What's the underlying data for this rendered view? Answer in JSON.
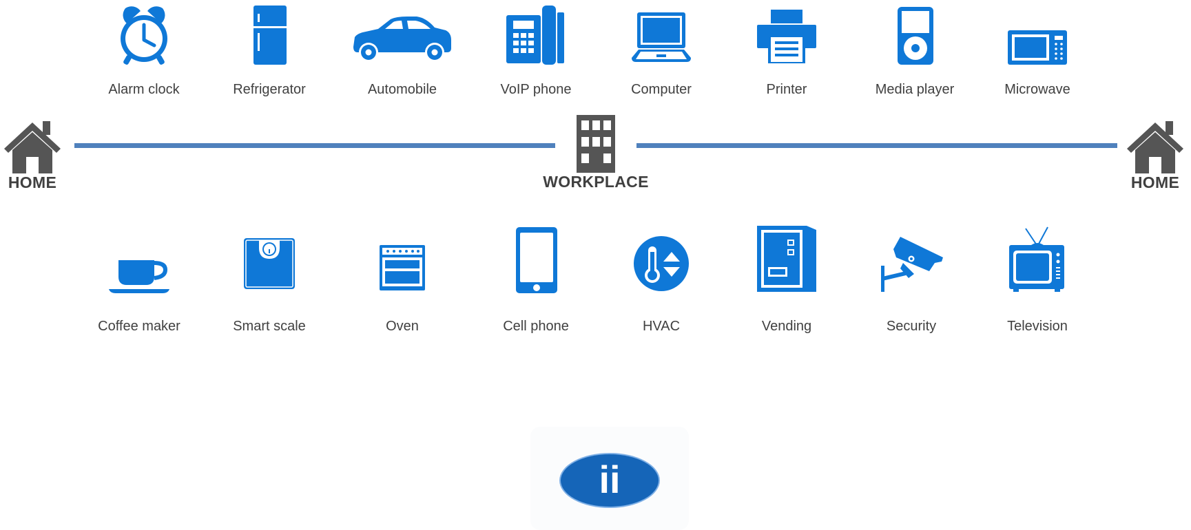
{
  "colors": {
    "icon_blue": "#0f78d7",
    "house_gray": "#555555",
    "line_blue": "#4f81bd",
    "label_gray": "#404040",
    "logo_blue": "#1565b8"
  },
  "top_devices": [
    {
      "label": "Alarm clock",
      "icon": "alarm-clock-icon"
    },
    {
      "label": "Refrigerator",
      "icon": "refrigerator-icon"
    },
    {
      "label": "Automobile",
      "icon": "automobile-icon"
    },
    {
      "label": "VoIP phone",
      "icon": "voip-phone-icon"
    },
    {
      "label": "Computer",
      "icon": "computer-icon"
    },
    {
      "label": "Printer",
      "icon": "printer-icon"
    },
    {
      "label": "Media player",
      "icon": "media-player-icon"
    },
    {
      "label": "Microwave",
      "icon": "microwave-icon"
    }
  ],
  "places": {
    "home_left": "HOME",
    "workplace": "WORKPLACE",
    "home_right": "HOME"
  },
  "bottom_devices": [
    {
      "label": "Coffee maker",
      "icon": "coffee-maker-icon"
    },
    {
      "label": "Smart scale",
      "icon": "smart-scale-icon"
    },
    {
      "label": "Oven",
      "icon": "oven-icon"
    },
    {
      "label": "Cell phone",
      "icon": "cell-phone-icon"
    },
    {
      "label": "HVAC",
      "icon": "hvac-icon"
    },
    {
      "label": "Vending",
      "icon": "vending-icon"
    },
    {
      "label": "Security",
      "icon": "security-camera-icon"
    },
    {
      "label": "Television",
      "icon": "television-icon"
    }
  ],
  "logo": {
    "text": "ii"
  }
}
